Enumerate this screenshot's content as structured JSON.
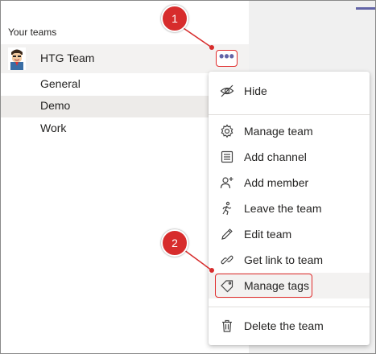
{
  "sidebar": {
    "section_label": "Your teams",
    "team": {
      "name": "HTG Team",
      "more_label": "•••"
    },
    "channels": [
      {
        "label": "General",
        "selected": false
      },
      {
        "label": "Demo",
        "selected": true
      },
      {
        "label": "Work",
        "selected": false
      }
    ]
  },
  "menu": {
    "items": [
      {
        "label": "Hide",
        "icon": "hide-icon"
      },
      {
        "label": "Manage team",
        "icon": "gear-icon"
      },
      {
        "label": "Add channel",
        "icon": "channel-list-icon"
      },
      {
        "label": "Add member",
        "icon": "add-person-icon"
      },
      {
        "label": "Leave the team",
        "icon": "walking-person-icon"
      },
      {
        "label": "Edit team",
        "icon": "pencil-icon"
      },
      {
        "label": "Get link to team",
        "icon": "link-icon"
      },
      {
        "label": "Manage tags",
        "icon": "tag-icon",
        "highlighted": true
      },
      {
        "label": "Delete the team",
        "icon": "trash-icon"
      }
    ]
  },
  "annotations": {
    "callout_1": "1",
    "callout_2": "2"
  },
  "colors": {
    "accent": "#6264a7",
    "callout": "#d72c2c",
    "highlight_box": "#e02b2b"
  }
}
